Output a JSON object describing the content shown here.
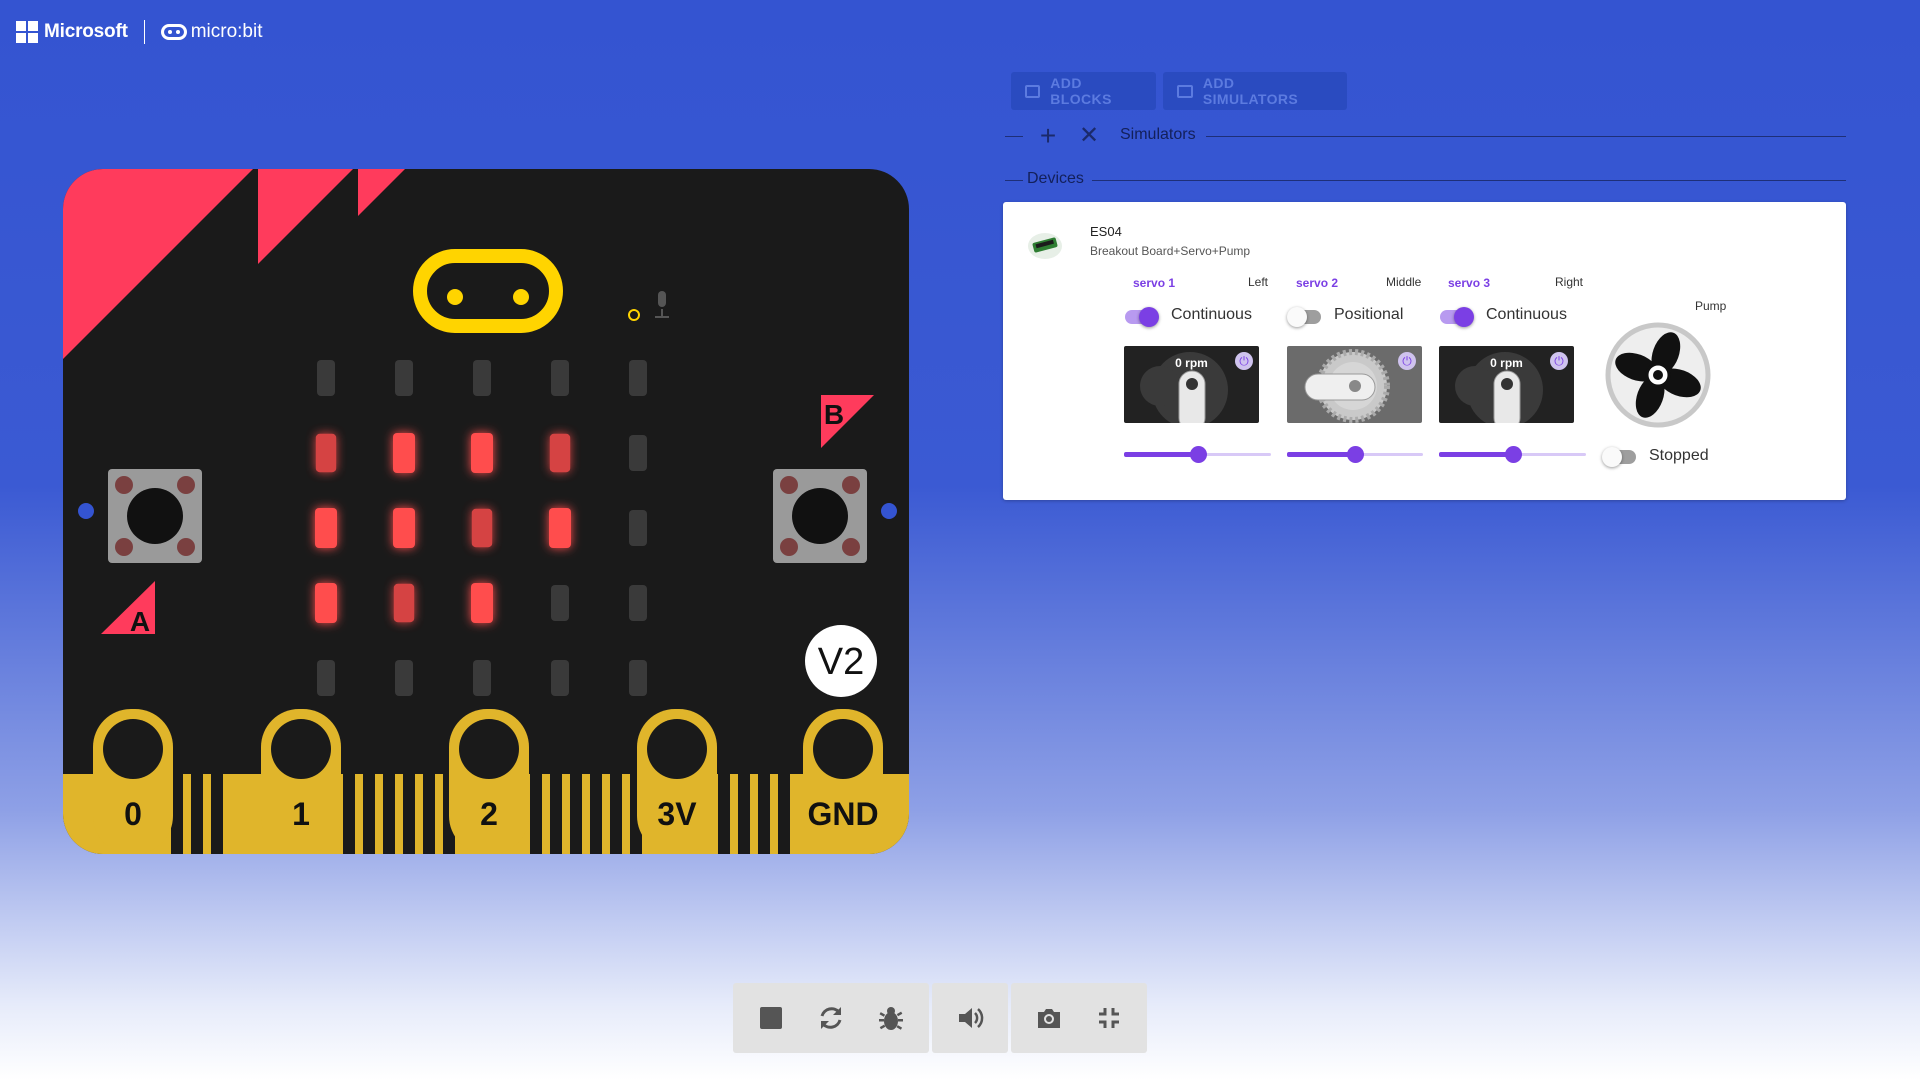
{
  "header": {
    "brand_text": "Microsoft",
    "product_text": "micro:bit"
  },
  "board": {
    "version_badge": "V2",
    "button_a_label": "A",
    "button_b_label": "B",
    "pins": [
      "0",
      "1",
      "2",
      "3V",
      "GND"
    ],
    "colors": {
      "body": "#1a1a1a",
      "accent": "#ff3b5c",
      "gold": "#e0b52b",
      "led_on": "#ff4d4d",
      "led_off": "#3a3a3a"
    },
    "led_grid": [
      [
        0,
        0,
        0,
        0,
        0
      ],
      [
        0.6,
        1,
        1,
        0.6,
        0
      ],
      [
        1,
        1,
        0.6,
        1,
        0
      ],
      [
        1,
        0.6,
        1,
        0,
        0
      ],
      [
        0,
        0,
        0,
        0,
        0
      ]
    ]
  },
  "panel": {
    "add_blocks_label": "ADD BLOCKS",
    "add_simulators_label": "ADD SIMULATORS",
    "simulators_label": "Simulators",
    "devices_label": "Devices"
  },
  "device": {
    "name": "ES04",
    "subtitle": "Breakout Board+Servo+Pump",
    "servos": [
      {
        "name": "servo 1",
        "position": "Left",
        "mode": "Continuous",
        "mode_on": true,
        "readout": "0 rpm",
        "slider_value": 0.5
      },
      {
        "name": "servo 2",
        "position": "Middle",
        "mode": "Positional",
        "mode_on": false,
        "readout": "",
        "slider_value": 0.5
      },
      {
        "name": "servo 3",
        "position": "Right",
        "mode": "Continuous",
        "mode_on": true,
        "readout": "0 rpm",
        "slider_value": 0.5
      }
    ],
    "pump": {
      "label": "Pump",
      "state": "Stopped",
      "on": false
    }
  },
  "toolbar": {
    "buttons": [
      "stop-icon",
      "restart-icon",
      "debug-icon",
      "sound-icon",
      "screenshot-icon",
      "focus-icon"
    ]
  }
}
